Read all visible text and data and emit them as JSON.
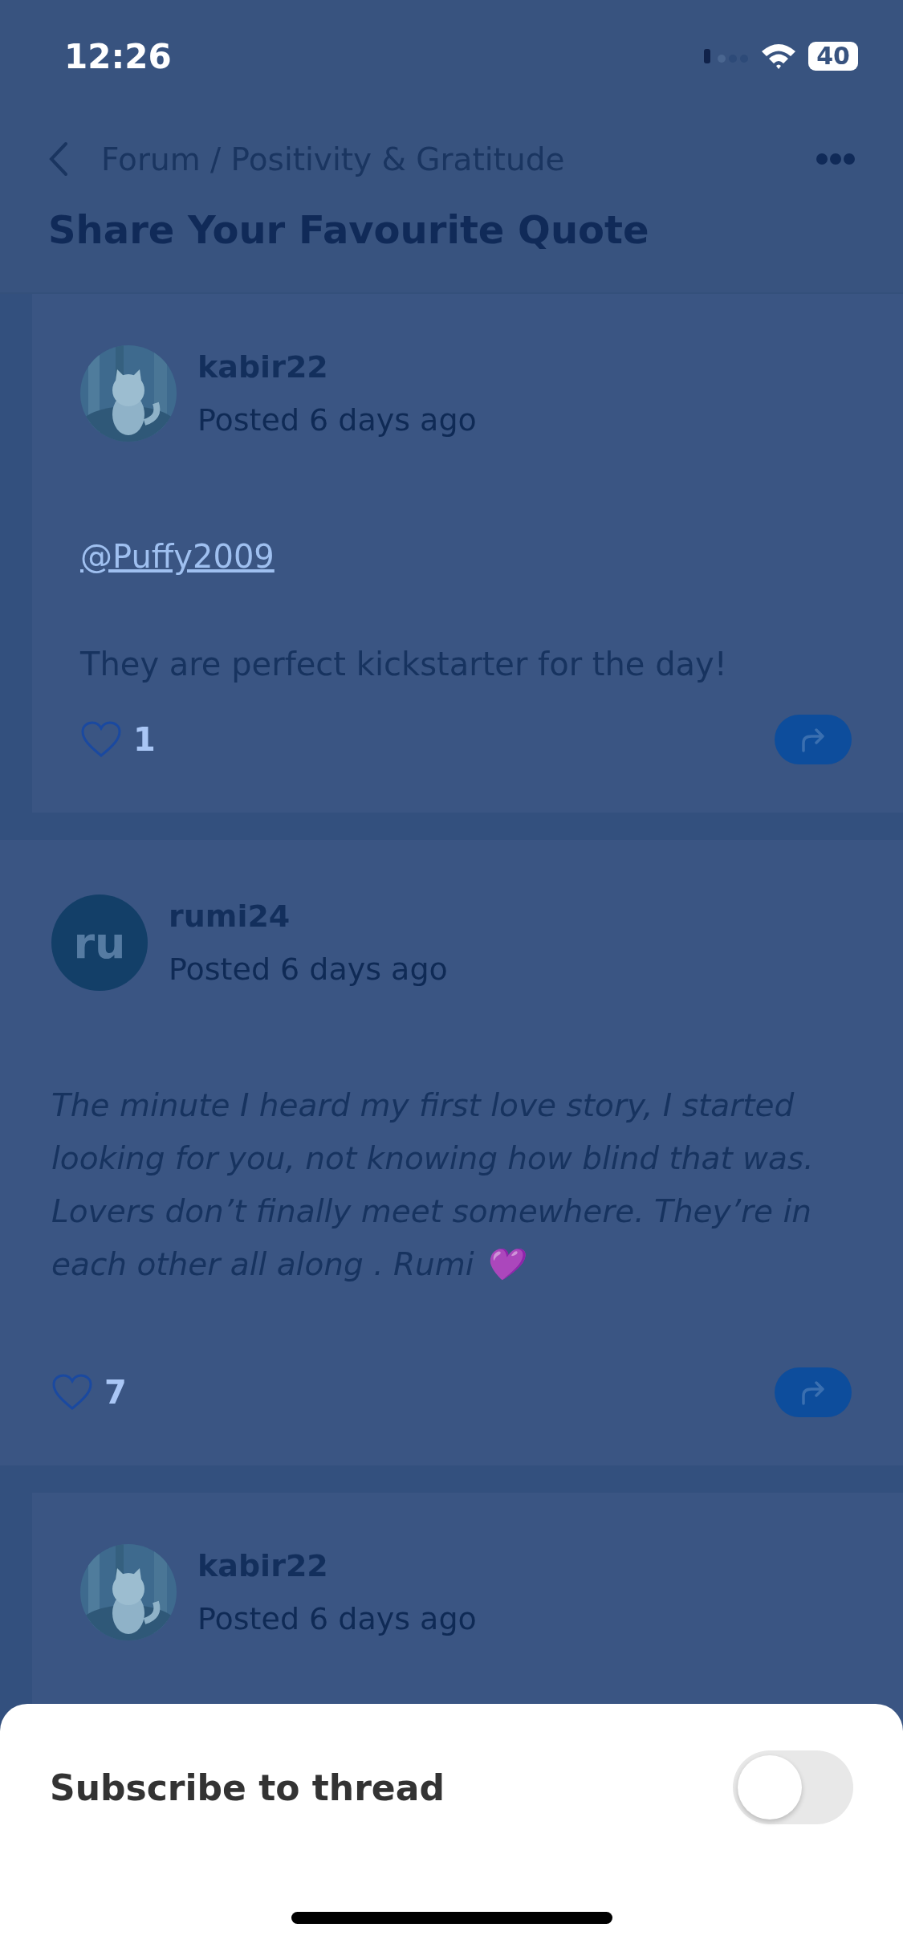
{
  "status_bar": {
    "time": "12:26",
    "battery": "40"
  },
  "nav": {
    "breadcrumb": "Forum / Positivity & Gratitude",
    "title": "Share Your Favourite Quote"
  },
  "posts": [
    {
      "indented": true,
      "avatar": {
        "kind": "picture"
      },
      "username": "kabir22",
      "meta": "Posted 6 days ago",
      "body": [
        {
          "kind": "mention",
          "text": "@Puffy2009"
        },
        {
          "kind": "text",
          "text": "They are perfect kickstarter for the day!"
        }
      ],
      "likes": "1",
      "liked": false
    },
    {
      "indented": false,
      "avatar": {
        "kind": "initials",
        "text": "ru"
      },
      "username": "rumi24",
      "meta": "Posted 6 days ago",
      "body": [
        {
          "kind": "quote",
          "text": "The minute I heard my first love story, I started looking for you, not knowing how blind that was. Lovers don’t finally meet somewhere. They’re in each other all along . Rumi 💜"
        }
      ],
      "likes": "7",
      "liked": false
    },
    {
      "indented": true,
      "avatar": {
        "kind": "picture"
      },
      "username": "kabir22",
      "meta": "Posted 6 days ago"
    }
  ],
  "sheet": {
    "label": "Subscribe to thread",
    "on": false
  }
}
